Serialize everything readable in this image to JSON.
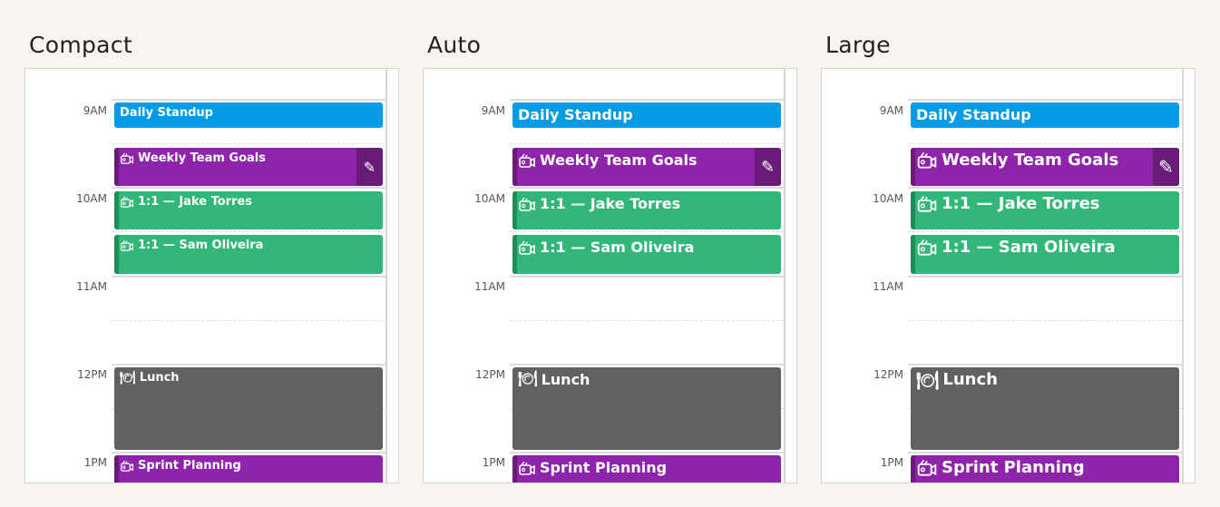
{
  "panels": [
    {
      "title": "Compact"
    },
    {
      "title": "Auto"
    },
    {
      "title": "Large"
    }
  ],
  "times": [
    "9AM",
    "10AM",
    "11AM",
    "12PM",
    "1PM"
  ],
  "events": {
    "standup": {
      "title": "Daily Standup",
      "color": "#039be5"
    },
    "weekly": {
      "title": "Weekly Team Goals",
      "color": "#8e24aa",
      "icon": "video-call-icon",
      "action_icon": "pencil-icon",
      "action_glyph": "✎"
    },
    "jake": {
      "title": "1:1 — Jake Torres",
      "color": "#33b679",
      "icon": "video-call-icon"
    },
    "sam": {
      "title": "1:1 — Sam Oliveira",
      "color": "#33b679",
      "icon": "video-call-icon"
    },
    "lunch": {
      "title": "Lunch",
      "color": "#616161",
      "icon": "cutlery-icon",
      "icon_glyph": "🍽"
    },
    "sprint": {
      "title": "Sprint Planning",
      "color": "#8e24aa",
      "icon": "video-call-icon"
    }
  }
}
